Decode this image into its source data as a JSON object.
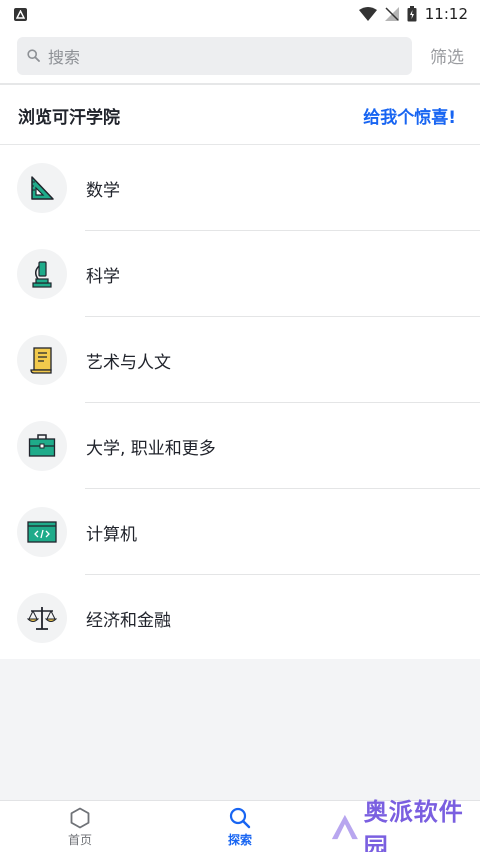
{
  "status_bar": {
    "time": "11:12"
  },
  "search": {
    "placeholder": "搜索",
    "filter_label": "筛选"
  },
  "header": {
    "title": "浏览可汗学院",
    "surprise_label": "给我个惊喜!"
  },
  "subjects": [
    {
      "label": "数学",
      "icon": "triangle-ruler-icon"
    },
    {
      "label": "科学",
      "icon": "microscope-icon"
    },
    {
      "label": "艺术与人文",
      "icon": "scroll-icon"
    },
    {
      "label": "大学, 职业和更多",
      "icon": "briefcase-icon"
    },
    {
      "label": "计算机",
      "icon": "code-window-icon"
    },
    {
      "label": "经济和金融",
      "icon": "balance-scale-icon"
    }
  ],
  "bottom_nav": {
    "home_label": "首页",
    "explore_label": "探索"
  },
  "watermark": {
    "text": "奥派软件园"
  },
  "colors": {
    "accent": "#1865f2",
    "icon_green": "#1fab8a",
    "icon_gold": "#f2c94c"
  }
}
